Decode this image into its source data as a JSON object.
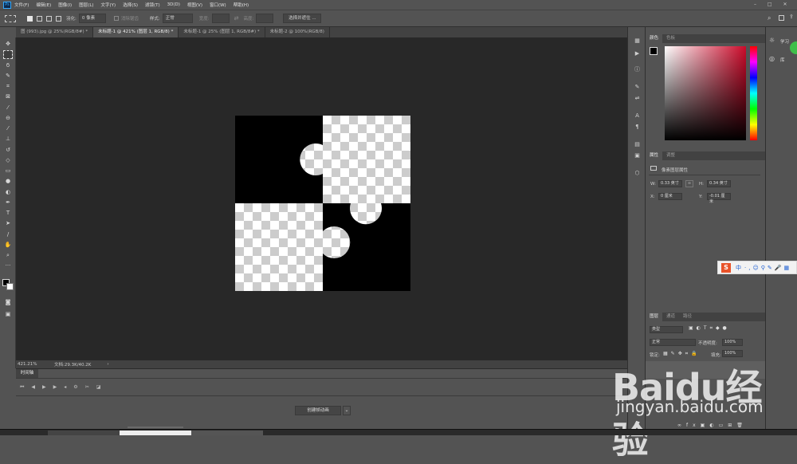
{
  "app": {
    "logo_label": "Ps"
  },
  "menu": [
    "文件(F)",
    "编辑(E)",
    "图像(I)",
    "图层(L)",
    "文字(Y)",
    "选择(S)",
    "滤镜(T)",
    "3D(D)",
    "视图(V)",
    "窗口(W)",
    "帮助(H)"
  ],
  "options": {
    "feather_label": "羽化:",
    "feather_value": "0 像素",
    "antialias_label": "消除锯齿",
    "style_label": "样式:",
    "style_value": "正常",
    "width_label": "宽度:",
    "height_label": "高度:",
    "select_mask_button": "选择并遮住 ..."
  },
  "tabs": [
    {
      "label": "图 (993).jpg @ 25%(RGB/8#) *",
      "active": false
    },
    {
      "label": "未标题-1 @ 421% (图层 1, RGB/8) *",
      "active": true
    },
    {
      "label": "未标题-1 @ 25% (图层 1, RGB/8#) *",
      "active": false
    },
    {
      "label": "未标题-2 @ 100%(RGB/8)",
      "active": false
    }
  ],
  "status": {
    "zoom": "421.21%",
    "doc": "文档:29.3K/40.2K"
  },
  "timeline": {
    "tab_label": "时间轴",
    "create_button": "创建帧动画"
  },
  "color_panel": {
    "tabs": [
      "颜色",
      "色板"
    ],
    "accent": "#cc0a2a"
  },
  "properties_panel": {
    "tabs": [
      "属性",
      "调整"
    ],
    "title": "像素图层属性",
    "w_label": "W:",
    "w_value": "0.33 英寸",
    "h_label": "H:",
    "h_value": "0.34 英寸",
    "x_label": "X:",
    "x_value": "0 厘米",
    "y_label": "Y:",
    "y_value": "-0.01 厘米"
  },
  "layers_panel": {
    "tabs": [
      "图层",
      "通道",
      "路径"
    ],
    "filter_value": "类型",
    "blend_value": "正常",
    "opacity_label": "不透明度:",
    "opacity_value": "100%",
    "lock_label": "锁定:",
    "fill_label": "填充:",
    "fill_value": "100%"
  },
  "right_strip": {
    "learn": "学习",
    "library": "库"
  },
  "ime": {
    "logo": "S",
    "label": "中"
  },
  "watermark": {
    "main": "Baidu经验",
    "url": "jingyan.baidu.com"
  }
}
